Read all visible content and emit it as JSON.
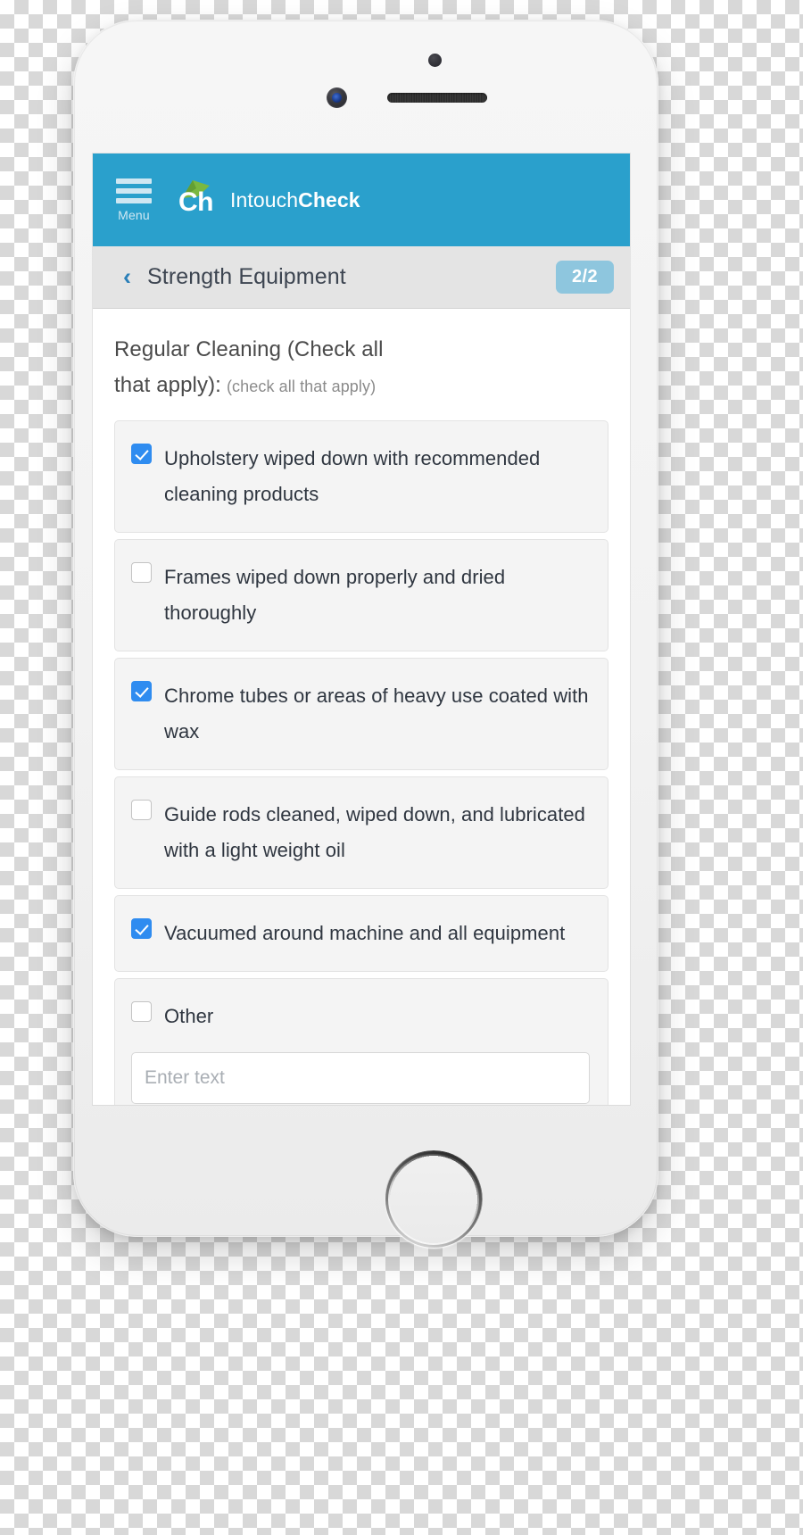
{
  "app": {
    "header": {
      "menu_label": "Menu",
      "logo_text": "Ch",
      "brand_prefix": "Intouch",
      "brand_suffix": "Check",
      "background_color": "#2aa0cc",
      "logo_accent_color": "#7ab840"
    },
    "nav": {
      "back_icon": "‹",
      "title": "Strength Equipment",
      "progress": "2/2",
      "badge_color": "#8ec6de"
    },
    "form": {
      "question_line_1": "Regular Cleaning (Check all",
      "question_line_2": "that apply):",
      "question_hint": "(check all that apply)",
      "options": [
        {
          "label": "Upholstery wiped down with recommended cleaning products",
          "checked": true
        },
        {
          "label": "Frames wiped down properly and dried thoroughly",
          "checked": false
        },
        {
          "label": "Chrome tubes or areas of heavy use coated with wax",
          "checked": true
        },
        {
          "label": "Guide rods cleaned, wiped down, and lubricated with a light weight oil",
          "checked": false
        },
        {
          "label": "Vacuumed around machine and all equipment",
          "checked": true
        },
        {
          "label": "Other",
          "checked": false,
          "has_text_input": true,
          "input_placeholder": "Enter text",
          "input_value": ""
        }
      ],
      "checked_color": "#2f8cf0"
    }
  },
  "device": {
    "body_color": "#f2f2f2",
    "hardware": [
      "sensor-dot",
      "camera-lens",
      "earpiece-speaker",
      "home-button"
    ]
  }
}
